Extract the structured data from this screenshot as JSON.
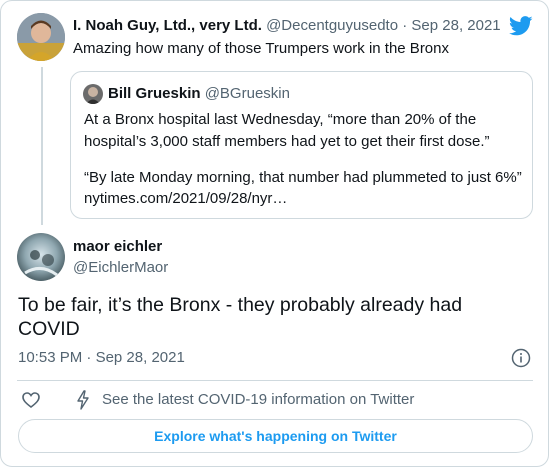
{
  "tweet_parent": {
    "display_name": "I. Noah Guy, Ltd., very Ltd.",
    "handle": "@Decentguyusedto",
    "separator": "·",
    "date": "Sep 28, 2021",
    "text": "Amazing how many of those Trumpers work in the Bronx"
  },
  "quoted_tweet": {
    "display_name": "Bill Grueskin",
    "handle": "@BGrueskin",
    "lines": [
      "At a Bronx hospital last Wednesday, “more than 20% of the",
      "hospital’s  3,000 staff members had yet to get their first dose.”",
      "",
      "“By late Monday morning, that number had plummeted to just 6%”",
      "nytimes.com/2021/09/28/nyr…"
    ]
  },
  "tweet_main": {
    "display_name": "maor eichler",
    "handle": "@EichlerMaor",
    "text_lines": [
      "To be fair, it’s the Bronx - they probably already had",
      "COVID"
    ],
    "time": "10:53 PM",
    "separator": "·",
    "date": "Sep 28, 2021"
  },
  "actions": {
    "covid_info": "See the latest COVID-19 information on Twitter"
  },
  "explore_button": "Explore what's happening on Twitter",
  "colors": {
    "twitter_blue": "#1d9bf0",
    "border": "#cfd9de",
    "muted_text": "#536471"
  },
  "icons": [
    "twitter-bird-icon",
    "info-icon",
    "heart-icon",
    "lightning-icon"
  ]
}
